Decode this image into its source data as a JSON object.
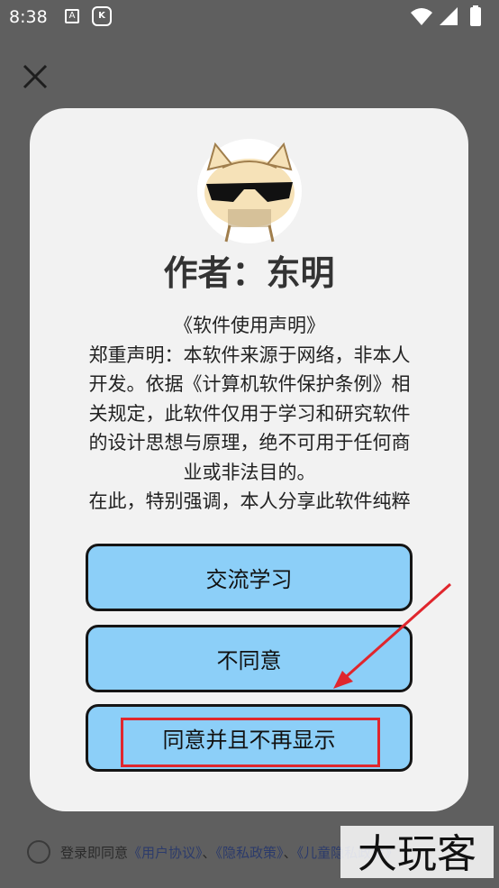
{
  "status_bar": {
    "time": "8:38",
    "notification_icons": [
      "text-notification-icon",
      "app-notification-icon"
    ],
    "right_icons": [
      "wifi-icon",
      "signal-icon",
      "battery-icon"
    ]
  },
  "dialog": {
    "author": "作者：东明",
    "statement_lines": [
      "《软件使用声明》",
      "郑重声明：本软件来源于网络，非本人",
      "开发。依据《计算机软件保护条例》相",
      "关规定，此软件仅用于学习和研究软件",
      "的设计思想与原理，绝不可用于任何商",
      "业或非法目的。",
      "在此，特别强调，本人分享此软件纯粹"
    ],
    "buttons": {
      "learn": "交流学习",
      "disagree": "不同意",
      "agree_no_show": "同意并且不再显示"
    }
  },
  "footer": {
    "prefix": "登录即同意",
    "user_agreement": "《用户协议》",
    "sep1": "、",
    "privacy_policy": "《隐私政策》",
    "sep2": "、",
    "children": "《儿童隐私政策》"
  },
  "watermark": "大玩客",
  "colors": {
    "button_fill": "#8ccff8",
    "highlight": "#e0262d",
    "overlay": "#5f5f5f"
  }
}
